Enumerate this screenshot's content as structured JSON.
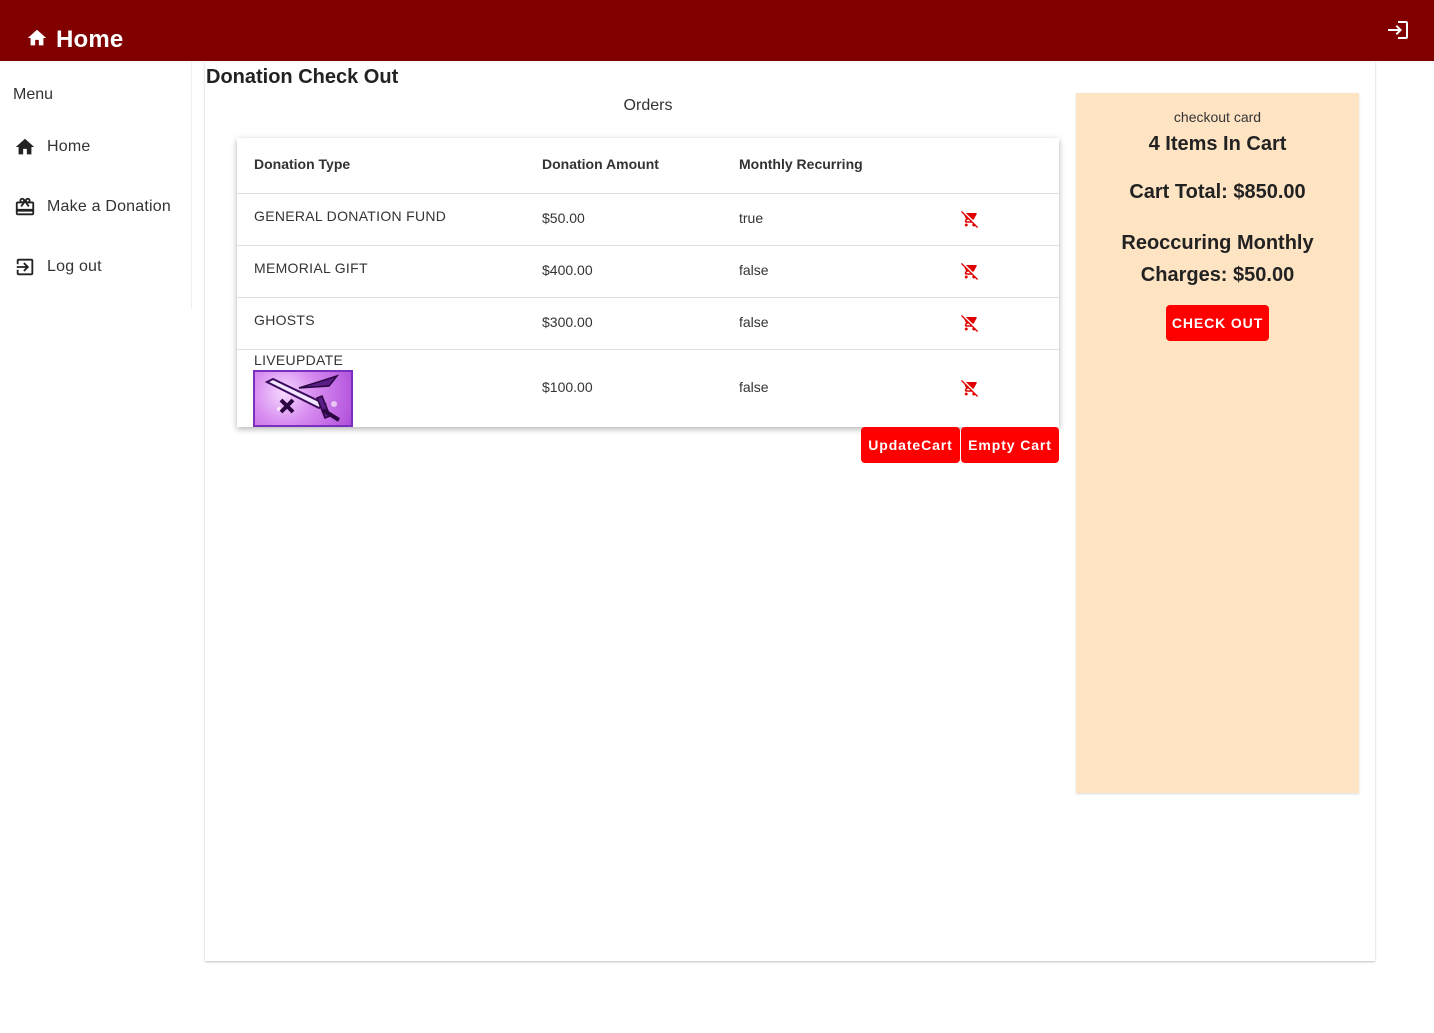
{
  "appbar": {
    "title": "Home",
    "home_icon": "home-icon",
    "login_icon": "login-icon"
  },
  "drawer": {
    "menu_title": "Menu",
    "items": [
      {
        "label": "Home",
        "icon": "home-icon"
      },
      {
        "label": "Make a Donation",
        "icon": "gift-icon"
      },
      {
        "label": "Log out",
        "icon": "logout-icon"
      }
    ]
  },
  "page": {
    "title": "Donation Check Out",
    "orders_title": "Orders"
  },
  "table": {
    "headers": [
      "Donation Type",
      "Donation Amount",
      "Monthly Recurring"
    ],
    "rows": [
      {
        "type": "GENERAL DONATION FUND",
        "amount": "$50.00",
        "recurring": "true",
        "remove_icon": "remove-from-cart-icon"
      },
      {
        "type": "MEMORIAL GIFT",
        "amount": "$400.00",
        "recurring": "false",
        "remove_icon": "remove-from-cart-icon"
      },
      {
        "type": "GHOSTS",
        "amount": "$300.00",
        "recurring": "false",
        "remove_icon": "remove-from-cart-icon"
      },
      {
        "type": "LIVEUPDATE",
        "amount": "$100.00",
        "recurring": "false",
        "remove_icon": "remove-from-cart-icon",
        "image": "dagger-image"
      }
    ]
  },
  "actions": {
    "update_cart": "UpdateCart",
    "empty_cart": "Empty Cart"
  },
  "checkout": {
    "label": "checkout card",
    "items_in_cart": "4 Items In Cart",
    "cart_total": "Cart Total: $850.00",
    "recurring": "Reoccuring Monthly Charges: $50.00",
    "button": "CHECK OUT"
  },
  "colors": {
    "appbar": "#800000",
    "button": "#ff0000",
    "checkout_card": "#ffe4c4",
    "remove_icon": "#e00000"
  }
}
